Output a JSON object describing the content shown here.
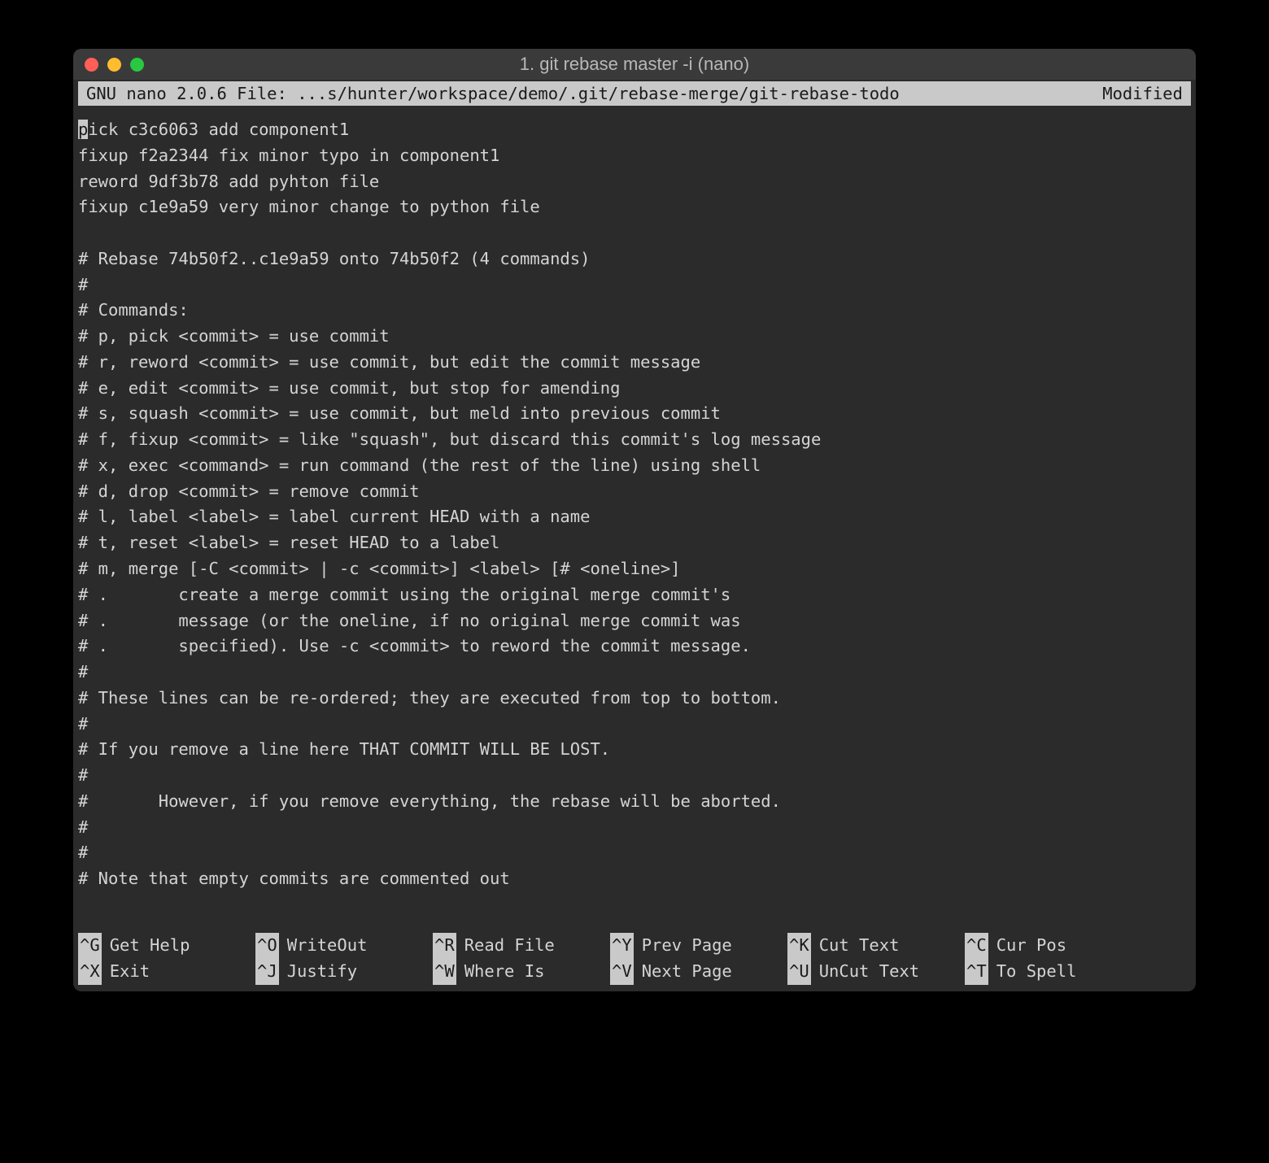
{
  "window": {
    "title": "1. git rebase master -i (nano)"
  },
  "nano": {
    "app": "GNU nano 2.0.6",
    "file_label": "File:",
    "file_path": "...s/hunter/workspace/demo/.git/rebase-merge/git-rebase-todo",
    "status": "Modified"
  },
  "editor": {
    "cursor_char": "p",
    "lines": [
      "ick c3c6063 add component1",
      "fixup f2a2344 fix minor typo in component1",
      "reword 9df3b78 add pyhton file",
      "fixup c1e9a59 very minor change to python file",
      "",
      "# Rebase 74b50f2..c1e9a59 onto 74b50f2 (4 commands)",
      "#",
      "# Commands:",
      "# p, pick <commit> = use commit",
      "# r, reword <commit> = use commit, but edit the commit message",
      "# e, edit <commit> = use commit, but stop for amending",
      "# s, squash <commit> = use commit, but meld into previous commit",
      "# f, fixup <commit> = like \"squash\", but discard this commit's log message",
      "# x, exec <command> = run command (the rest of the line) using shell",
      "# d, drop <commit> = remove commit",
      "# l, label <label> = label current HEAD with a name",
      "# t, reset <label> = reset HEAD to a label",
      "# m, merge [-C <commit> | -c <commit>] <label> [# <oneline>]",
      "# .       create a merge commit using the original merge commit's",
      "# .       message (or the oneline, if no original merge commit was",
      "# .       specified). Use -c <commit> to reword the commit message.",
      "#",
      "# These lines can be re-ordered; they are executed from top to bottom.",
      "#",
      "# If you remove a line here THAT COMMIT WILL BE LOST.",
      "#",
      "#       However, if you remove everything, the rebase will be aborted.",
      "#",
      "#",
      "# Note that empty commits are commented out"
    ]
  },
  "shortcuts": {
    "row1": [
      {
        "key": "^G",
        "label": "Get Help"
      },
      {
        "key": "^O",
        "label": "WriteOut"
      },
      {
        "key": "^R",
        "label": "Read File"
      },
      {
        "key": "^Y",
        "label": "Prev Page"
      },
      {
        "key": "^K",
        "label": "Cut Text"
      },
      {
        "key": "^C",
        "label": "Cur Pos"
      }
    ],
    "row2": [
      {
        "key": "^X",
        "label": "Exit"
      },
      {
        "key": "^J",
        "label": "Justify"
      },
      {
        "key": "^W",
        "label": "Where Is"
      },
      {
        "key": "^V",
        "label": "Next Page"
      },
      {
        "key": "^U",
        "label": "UnCut Text"
      },
      {
        "key": "^T",
        "label": "To Spell"
      }
    ]
  }
}
